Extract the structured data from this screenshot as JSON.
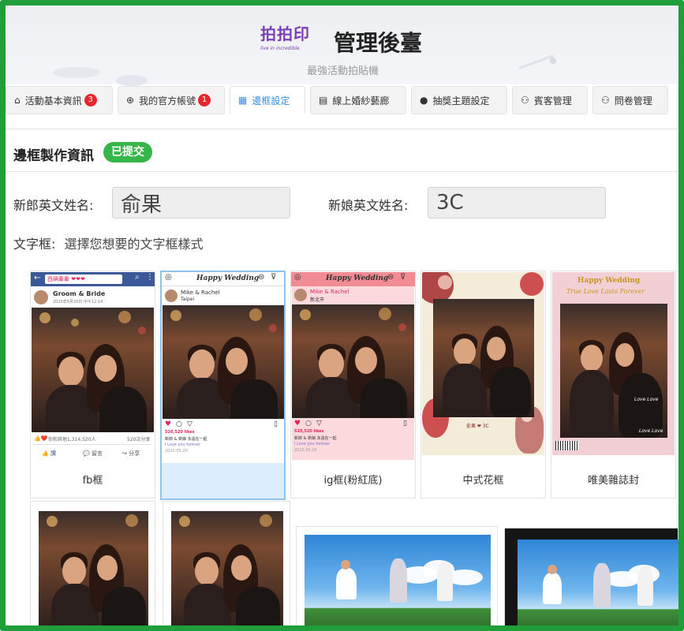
{
  "header": {
    "logo_text": "拍拍印",
    "logo_tagline": "live in incredible.",
    "title": "管理後臺",
    "subtitle": "最強活動拍貼機"
  },
  "tabs": [
    {
      "label": "活動基本資訊",
      "icon": "home-icon",
      "badge": "3",
      "active": false
    },
    {
      "label": "我的官方帳號",
      "icon": "globe-icon",
      "badge": "1",
      "active": false
    },
    {
      "label": "邊框設定",
      "icon": "frame-icon",
      "badge": "",
      "active": true
    },
    {
      "label": "線上婚紗藝廊",
      "icon": "document-icon",
      "badge": "",
      "active": false
    },
    {
      "label": "抽獎主題設定",
      "icon": "apple-icon",
      "badge": "",
      "active": false
    },
    {
      "label": "賓客管理",
      "icon": "users-icon",
      "badge": "",
      "active": false
    },
    {
      "label": "問卷管理",
      "icon": "users-icon",
      "badge": "",
      "active": false
    }
  ],
  "section": {
    "title": "邊框製作資訊",
    "status": "已提交"
  },
  "form": {
    "groom_label": "新郎英文姓名:",
    "groom_value": "俞果",
    "bride_label": "新娘英文姓名:",
    "bride_value": "3C",
    "textframe_label": "文字框:",
    "textframe_hint": "選擇您想要的文字框樣式"
  },
  "frames": [
    {
      "caption": "fb框",
      "search_text": "西嶼牽牽 ❤❤❤",
      "post_name": "Groom & Bride",
      "post_date": "2020年5月20日 中午12:14 ·",
      "reactions": "你和其他1,314,520人",
      "shares": "520次分享",
      "action_like": "讚",
      "action_comment": "留言",
      "action_share": "分享"
    },
    {
      "caption": "",
      "banner": "Happy Wedding",
      "names": "Mike & Rachel",
      "location": "Taipei",
      "likes": "520,520 likes",
      "line1": "新郎 & 新娘 永遠在一起",
      "line2": "I Love you forever",
      "date": "2020.05.20"
    },
    {
      "caption": "ig框(粉紅底)",
      "banner": "Happy Wedding",
      "names": "Mike & Rachel",
      "location": "新北市",
      "likes": "520,520 likes",
      "line1": "新郎 & 新娘 永遠在一起",
      "line2": "I Love you forever",
      "date": "2020.05.20"
    },
    {
      "caption": "中式花框",
      "couple_text": "俞果 ❤ 3C"
    },
    {
      "caption": "唯美雜誌封",
      "line1": "Happy Wedding",
      "line2": "True Love Lasts Forever",
      "side1": "Love Love",
      "side2": "Love Love"
    }
  ],
  "colors": {
    "frame_border": "#1f9e3a",
    "status_green": "#36b54a",
    "badge_red": "#e8262d",
    "active_tab": "#3a8ee6",
    "fb_blue": "#3b5998",
    "ig_pink": "#f28c94",
    "selected_bg": "#dceefe"
  }
}
